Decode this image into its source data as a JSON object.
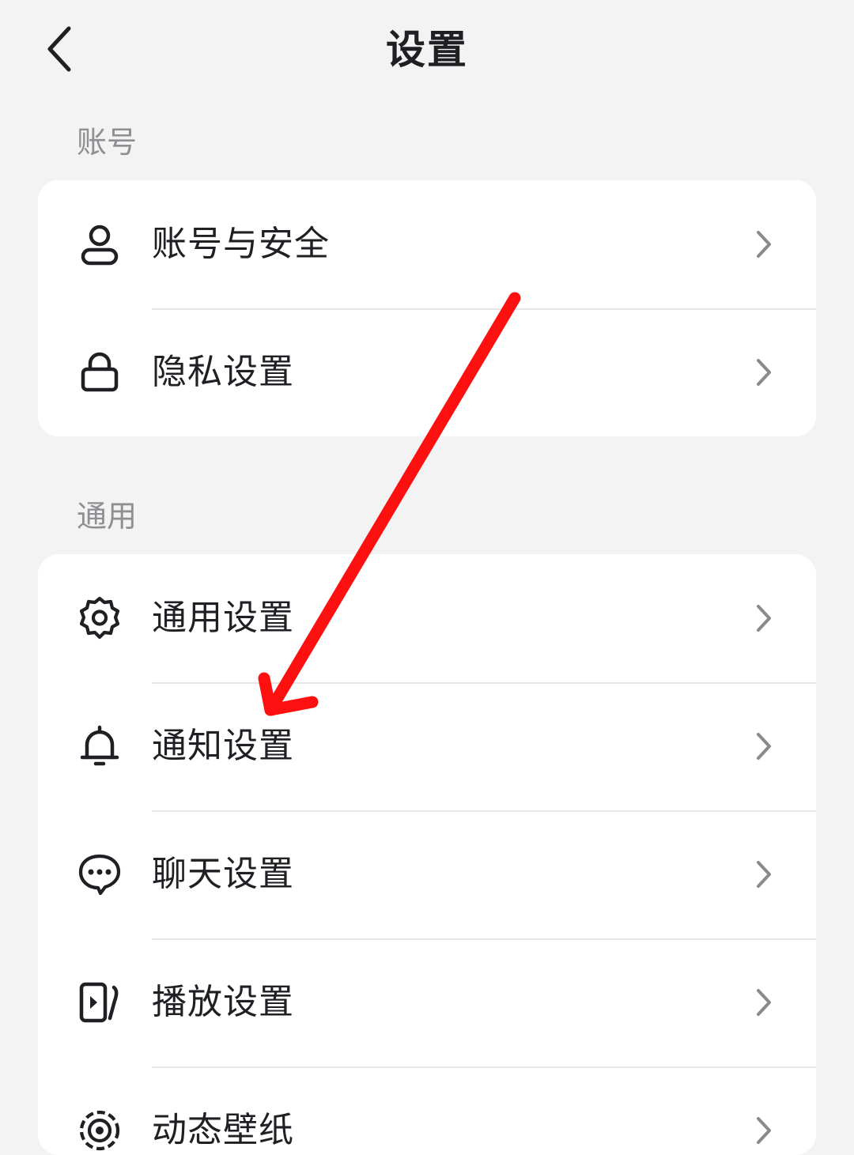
{
  "header": {
    "title": "设置",
    "back_icon": "chevron-left-icon"
  },
  "sections": [
    {
      "label": "账号",
      "items": [
        {
          "label": "账号与安全",
          "icon": "user-icon"
        },
        {
          "label": "隐私设置",
          "icon": "lock-icon"
        }
      ]
    },
    {
      "label": "通用",
      "items": [
        {
          "label": "通用设置",
          "icon": "gear-icon"
        },
        {
          "label": "通知设置",
          "icon": "bell-icon"
        },
        {
          "label": "聊天设置",
          "icon": "chat-bubble-icon"
        },
        {
          "label": "播放设置",
          "icon": "play-screen-icon"
        },
        {
          "label": "动态壁纸",
          "icon": "live-wallpaper-icon"
        }
      ]
    }
  ],
  "annotation": {
    "type": "red-arrow",
    "color": "#ff0000",
    "points_to": "通知设置"
  }
}
